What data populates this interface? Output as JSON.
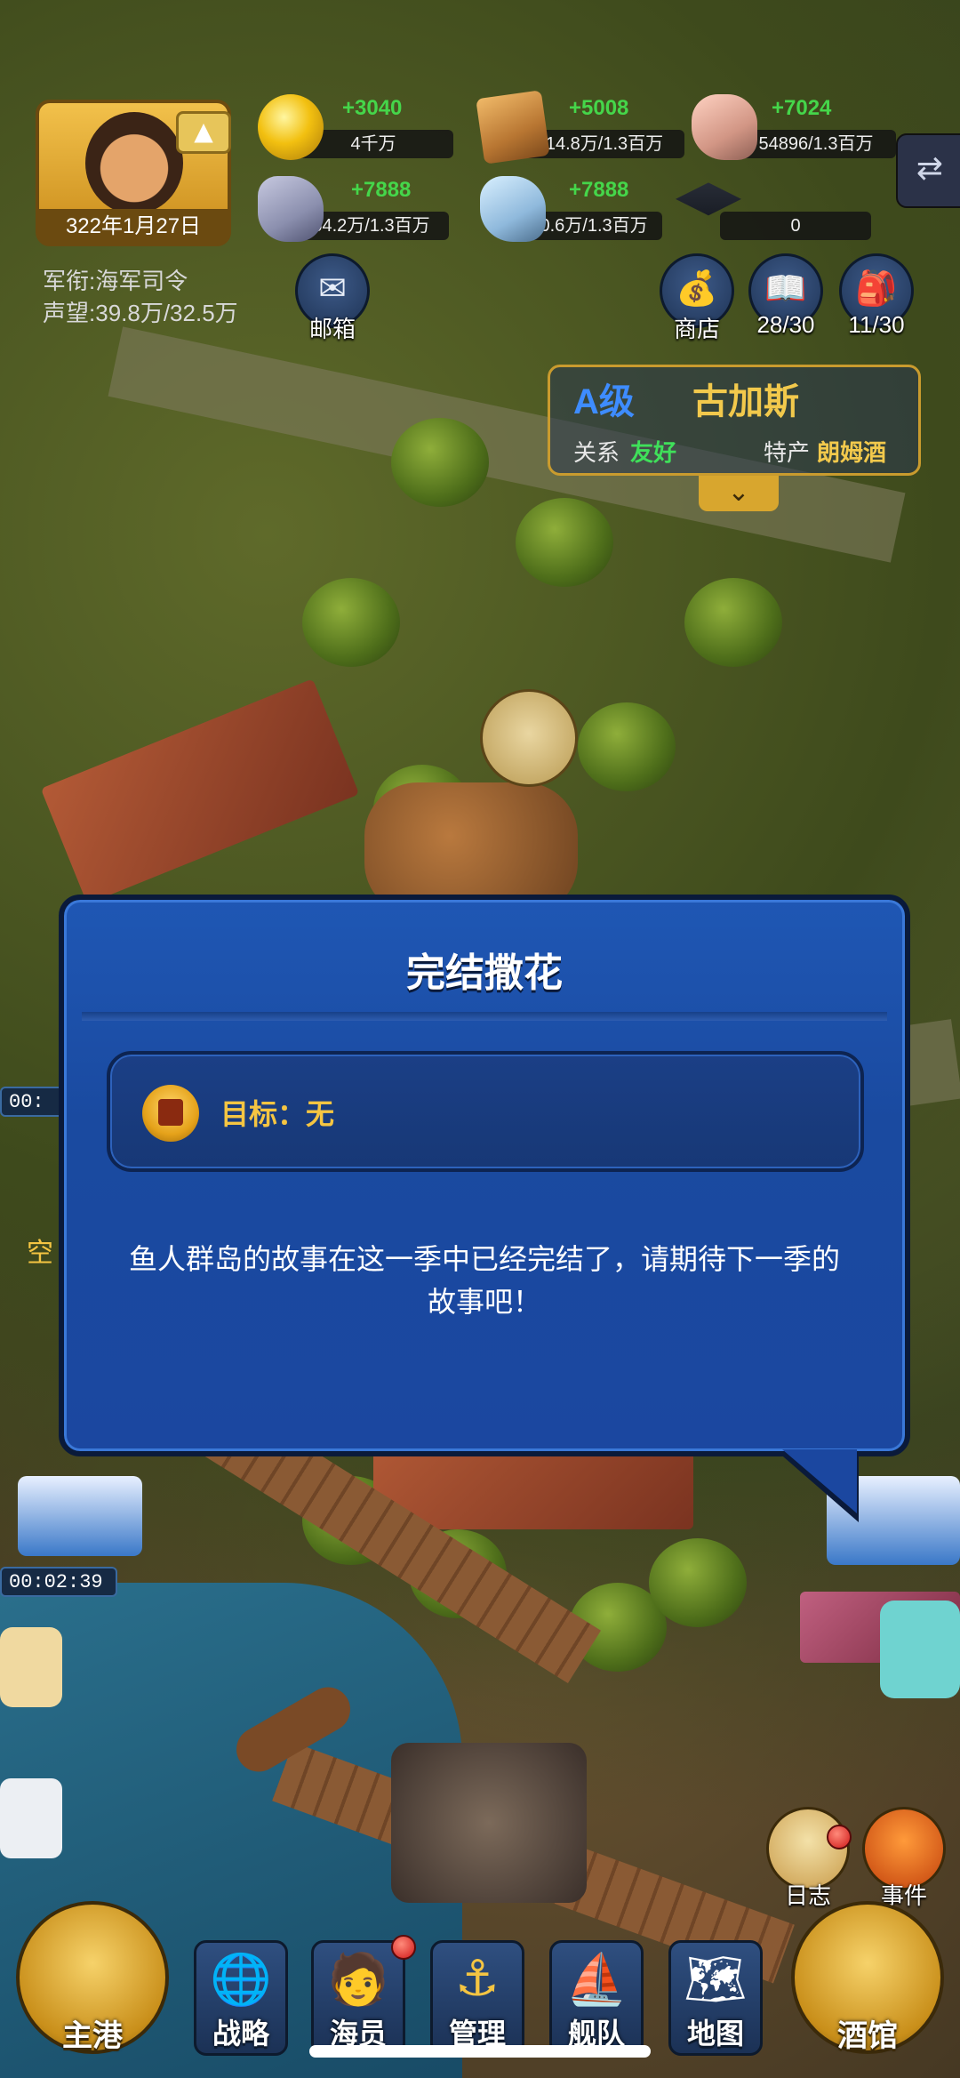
{
  "player": {
    "date": "322年1月27日",
    "title_label": "军衔:",
    "title_value": "海军司令",
    "prestige_label": "声望:",
    "prestige_value": "39.8万/32.5万"
  },
  "resources": [
    {
      "icon": "gold-icon",
      "gain": "+3040",
      "amount": "4千万"
    },
    {
      "icon": "wood-icon",
      "gain": "+5008",
      "amount": "14.8万/1.3百万"
    },
    {
      "icon": "stone-icon",
      "gain": "+7024",
      "amount": "54896/1.3百万"
    },
    {
      "icon": "iron-icon",
      "gain": "+7888",
      "amount": "64.2万/1.3百万"
    },
    {
      "icon": "crystal-icon",
      "gain": "+7888",
      "amount": "10.6万/1.3百万"
    },
    {
      "icon": "graduation-cap-icon",
      "gain": "",
      "amount": "0"
    }
  ],
  "menu": {
    "mail": "邮箱",
    "shop": "商店",
    "book_count": "28/30",
    "bag_count": "11/30"
  },
  "city": {
    "grade": "A级",
    "name": "古加斯",
    "relation_label": "关系",
    "relation_value": "友好",
    "specialty_label": "特产",
    "specialty_value": "朗姆酒"
  },
  "timers": {
    "left_mid": "00:",
    "left_mid_label": "空",
    "ship": "00:02:39"
  },
  "dialog": {
    "title": "完结撒花",
    "goal": "目标：无",
    "message": "鱼人群岛的故事在这一季中已经完结了，请期待下一季的故事吧！"
  },
  "side_buttons": {
    "log": "日志",
    "events": "事件"
  },
  "nav": {
    "home": "主港",
    "strategy": "战略",
    "crew": "海员",
    "manage": "管理",
    "fleet": "舰队",
    "map": "地图",
    "tavern": "酒馆"
  },
  "colors": {
    "dialog_blue": "#1f57b4",
    "gain_green": "#45d64a",
    "city_grade_blue": "#3e8cff",
    "city_name_gold": "#f2c94c",
    "relation_green": "#3fe05a",
    "specialty_gold": "#f2c94c",
    "goal_gold": "#f5c542"
  }
}
